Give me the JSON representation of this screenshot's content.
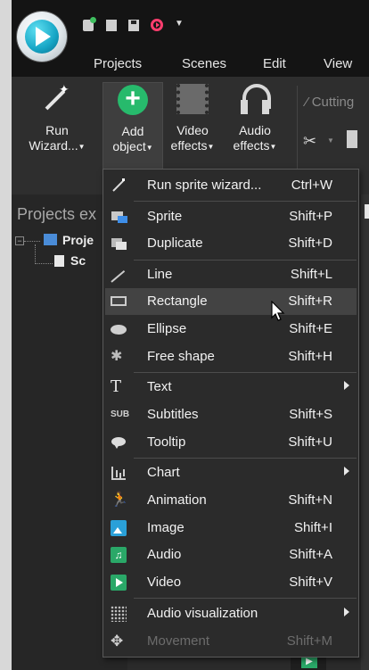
{
  "menu_tabs": {
    "projects": "Projects",
    "scenes": "Scenes",
    "edit": "Edit",
    "view": "View"
  },
  "ribbon": {
    "run_wizard": "Run",
    "run_wizard_2": "Wizard...",
    "add_object": "Add",
    "add_object_2": "object",
    "video_effects": "Video",
    "video_effects_2": "effects",
    "audio_effects": "Audio",
    "audio_effects_2": "effects",
    "cutting": "Cutting"
  },
  "left_panel": {
    "title": "Projects ex",
    "tree_project": "Proje",
    "tree_scene": "Sc"
  },
  "dropdown": {
    "items": [
      {
        "label": "Run sprite wizard...",
        "shortcut": "Ctrl+W",
        "icon": "magic-wand-icon"
      },
      {
        "label": "Sprite",
        "shortcut": "Shift+P",
        "icon": "sprite-icon"
      },
      {
        "label": "Duplicate",
        "shortcut": "Shift+D",
        "icon": "duplicate-icon"
      },
      {
        "label": "Line",
        "shortcut": "Shift+L",
        "icon": "line-icon"
      },
      {
        "label": "Rectangle",
        "shortcut": "Shift+R",
        "icon": "rectangle-icon"
      },
      {
        "label": "Ellipse",
        "shortcut": "Shift+E",
        "icon": "ellipse-icon"
      },
      {
        "label": "Free shape",
        "shortcut": "Shift+H",
        "icon": "free-shape-icon"
      },
      {
        "label": "Text",
        "shortcut": "",
        "icon": "text-icon"
      },
      {
        "label": "Subtitles",
        "shortcut": "Shift+S",
        "icon": "subtitles-icon"
      },
      {
        "label": "Tooltip",
        "shortcut": "Shift+U",
        "icon": "tooltip-icon"
      },
      {
        "label": "Chart",
        "shortcut": "",
        "icon": "chart-icon"
      },
      {
        "label": "Animation",
        "shortcut": "Shift+N",
        "icon": "animation-icon"
      },
      {
        "label": "Image",
        "shortcut": "Shift+I",
        "icon": "image-icon"
      },
      {
        "label": "Audio",
        "shortcut": "Shift+A",
        "icon": "audio-icon"
      },
      {
        "label": "Video",
        "shortcut": "Shift+V",
        "icon": "video-icon"
      },
      {
        "label": "Audio visualization",
        "shortcut": "",
        "icon": "audio-visualization-icon"
      },
      {
        "label": "Movement",
        "shortcut": "Shift+M",
        "icon": "movement-icon",
        "disabled": true
      }
    ]
  },
  "colors": {
    "accent_green": "#27ba6c",
    "menu_bg": "#2b2b2b",
    "titlebar_bg": "#141414",
    "hover_bg": "#434343"
  }
}
